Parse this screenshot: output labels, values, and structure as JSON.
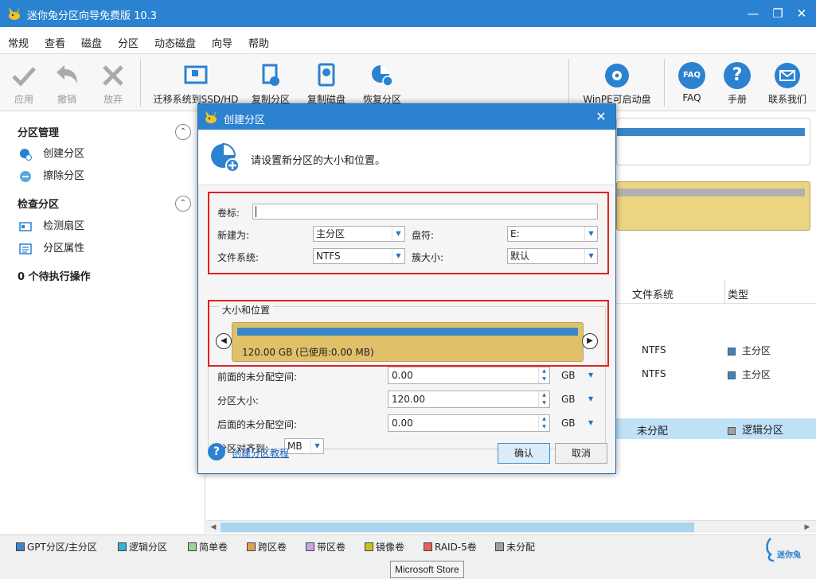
{
  "window": {
    "title": "迷你兔分区向导免费版 10.3",
    "minimize": "—",
    "restore": "❐",
    "close": "✕"
  },
  "menu": [
    "常规",
    "查看",
    "磁盘",
    "分区",
    "动态磁盘",
    "向导",
    "帮助"
  ],
  "toolbar": {
    "apply": "应用",
    "undo": "撤销",
    "discard": "放弃",
    "migrate": "迁移系统到SSD/HD",
    "copy_partition": "复制分区",
    "copy_disk": "复制磁盘",
    "recover_partition": "恢复分区",
    "winpe": "WinPE可启动盘",
    "faq": "FAQ",
    "manual": "手册",
    "contact": "联系我们",
    "faq_icon_text": "FAQ"
  },
  "left_panel": {
    "partition_management": "分区管理",
    "create_partition": "创建分区",
    "wipe_partition": "擦除分区",
    "check_partition": "检查分区",
    "check_sector": "检测扇区",
    "partition_properties": "分区属性",
    "pending_ops": "0 个待执行操作",
    "collapse": "⌃"
  },
  "table": {
    "col_filesystem": "文件系统",
    "col_type": "类型",
    "rows": [
      {
        "fs": "NTFS",
        "type": "主分区"
      },
      {
        "fs": "NTFS",
        "type": "主分区"
      },
      {
        "fs": "未分配",
        "type": "逻辑分区"
      }
    ]
  },
  "legend": [
    {
      "label": "GPT分区/主分区",
      "color": "#3a86c8"
    },
    {
      "label": "逻辑分区",
      "color": "#34b3d9"
    },
    {
      "label": "简单卷",
      "color": "#9fd19a"
    },
    {
      "label": "跨区卷",
      "color": "#d7a35c"
    },
    {
      "label": "带区卷",
      "color": "#c9a7dc"
    },
    {
      "label": "镜像卷",
      "color": "#c9c21d"
    },
    {
      "label": "RAID-5卷",
      "color": "#e8605c"
    },
    {
      "label": "未分配",
      "color": "#a0a0a0"
    }
  ],
  "brand": "迷你兔",
  "tooltip": "Microsoft Store",
  "dialog": {
    "title": "创建分区",
    "close": "✕",
    "header_text": "请设置新分区的大小和位置。",
    "volume_label_label": "卷标:",
    "volume_label_value": "",
    "create_as_label": "新建为:",
    "create_as_value": "主分区",
    "drive_letter_label": "盘符:",
    "drive_letter_value": "E:",
    "file_system_label": "文件系统:",
    "file_system_value": "NTFS",
    "cluster_size_label": "簇大小:",
    "cluster_size_value": "默认",
    "size_position_title": "大小和位置",
    "partition_bar_text": "120.00 GB (已使用:0.00 MB)",
    "unallocated_before_label": "前面的未分配空间:",
    "unallocated_before_value": "0.00",
    "partition_size_label": "分区大小:",
    "partition_size_value": "120.00",
    "unallocated_after_label": "后面的未分配空间:",
    "unallocated_after_value": "0.00",
    "unit": "GB",
    "align_label": "分区对齐到:",
    "align_value": "MB",
    "help_link": "创建分区教程",
    "ok": "确认",
    "cancel": "取消",
    "help_icon": "?"
  },
  "colors": {
    "title_bar": "#2b82d0",
    "highlight_border": "#e02020",
    "partition_fill": "#e0c16a",
    "partition_used": "#3a86c8"
  }
}
